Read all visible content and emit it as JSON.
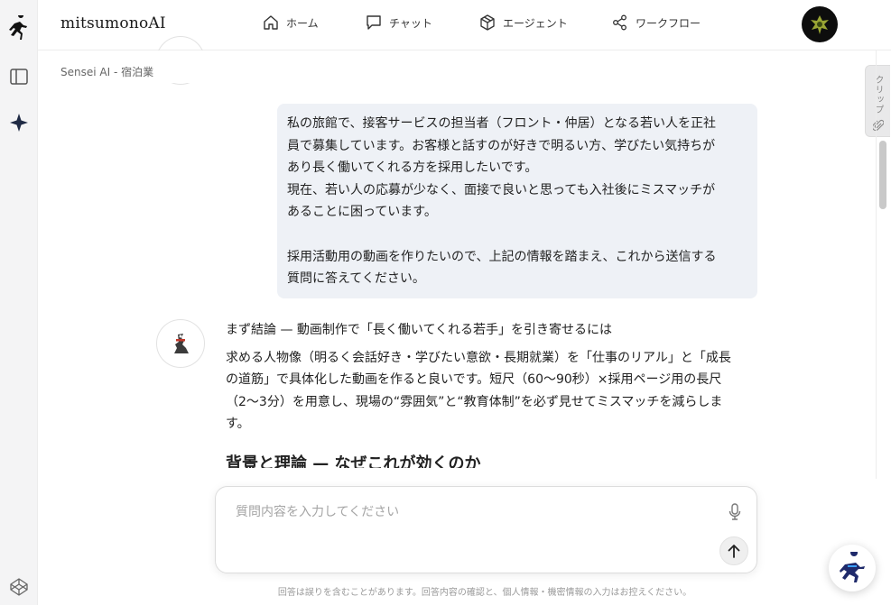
{
  "app": {
    "brand": "mitsumonoAI"
  },
  "nav": [
    {
      "label": "ホーム",
      "icon": "home-icon"
    },
    {
      "label": "チャット",
      "icon": "chat-icon"
    },
    {
      "label": "エージェント",
      "icon": "cube-icon"
    },
    {
      "label": "ワークフロー",
      "icon": "share-icon"
    }
  ],
  "breadcrumb": "Sensei AI - 宿泊業",
  "clip": {
    "label": "クリップ"
  },
  "user_message": {
    "lines": [
      "私の旅館で、接客サービスの担当者（フロント・仲居）となる若い人を正社",
      "員で募集しています。お客様と話すのが好きで明るい方、学びたい気持ちが",
      "あり長く働いてくれる方を採用したいです。",
      "現在、若い人の応募が少なく、面接で良いと思っても入社後にミスマッチが",
      "あることに困っています。",
      "採用活動用の動画を作りたいので、上記の情報を踏まえ、これから送信する",
      "質問に答えてください。"
    ]
  },
  "assistant_message": {
    "lead": "まず結論 — 動画制作で「長く働いてくれる若手」を引き寄せるには",
    "body": [
      "求める人物像（明るく会話好き・学びたい意欲・長期就業）を「仕事のリアル」と「成長",
      "の道筋」で具体化した動画を作ると良いです。短尺（60〜90秒）×採用ページ用の長尺",
      "（2〜3分）を用意し、現場の“雰囲気”と“教育体制”を必ず見せてミスマッチを減らしま",
      "す。"
    ],
    "heading": "背景と理論 — なぜこれが効くのか"
  },
  "composer": {
    "placeholder": "質問内容を入力してください"
  },
  "disclaimer": "回答は誤りを含むことがあります。回答内容の確認と、個人情報・機密情報の入力はお控えください。",
  "colors": {
    "bubble": "#eef1f6",
    "rail": "#f4f4f5",
    "accent": "#1f2a44"
  }
}
